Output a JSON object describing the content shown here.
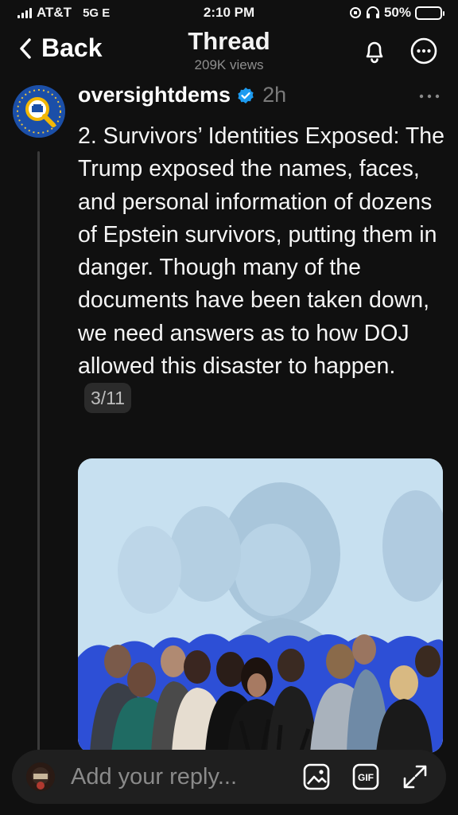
{
  "status_bar": {
    "carrier": "AT&T",
    "network": "5G E",
    "time": "2:10 PM",
    "battery": "50%",
    "battery_level": 0.5
  },
  "header": {
    "back_label": "Back",
    "title": "Thread",
    "views": "209K views"
  },
  "post": {
    "username": "oversightdems",
    "time_ago": "2h",
    "text": "2. Survivors’ Identities Exposed: The Trump exposed the names, faces, and personal information of dozens of Epstein survivors, putting them in danger. Though many of the documents have been taken down, we need answers as to how DOJ allowed this disaster to happen.",
    "counter": "3/11"
  },
  "reply_bar": {
    "placeholder": "Add your reply...",
    "gif_label": "GIF"
  },
  "icons": {
    "back": "chevron-left-icon",
    "notifications": "bell-icon",
    "menu": "more-icon",
    "verified": "verified-badge-icon",
    "image": "image-icon",
    "gif": "gif-icon",
    "expand": "expand-icon"
  },
  "colors": {
    "background": "#101010",
    "verified": "#1d9bf0",
    "muted": "#8e8e8e",
    "reply_bar": "#1f1f1f"
  }
}
